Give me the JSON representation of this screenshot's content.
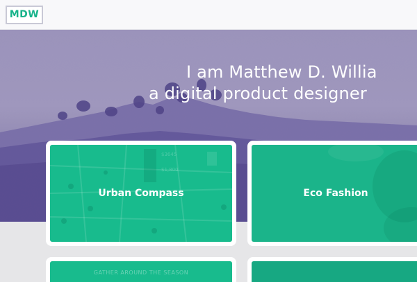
{
  "header": {
    "logo_text": "MDW"
  },
  "hero": {
    "line1": "I am Matthew D. Willia",
    "line2": "a digital product designer"
  },
  "projects": [
    {
      "label": "Urban Compass"
    },
    {
      "label": "Eco Fashion"
    },
    {
      "caption": "GATHER AROUND THE SEASON"
    },
    {
      "label": ""
    }
  ],
  "urban_compass_overlay": {
    "price_1": "$3645",
    "price_2": "$1,800"
  },
  "colors": {
    "accent_green": "#18bb8d",
    "hero_purple": "#5a4d93",
    "logo_green": "#17b38a"
  }
}
